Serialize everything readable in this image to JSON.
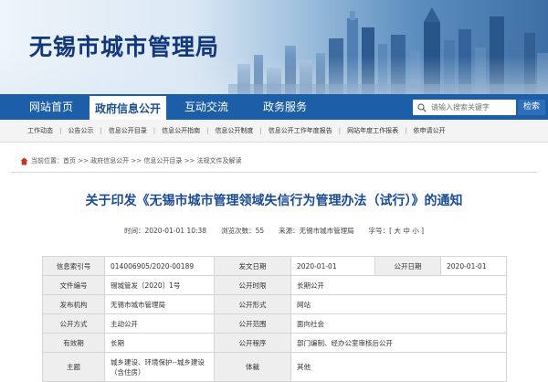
{
  "site": {
    "title": "无锡市城市管理局"
  },
  "nav": {
    "items": [
      {
        "label": "网站首页",
        "active": false
      },
      {
        "label": "政府信息公开",
        "active": true
      },
      {
        "label": "互动交流",
        "active": false
      },
      {
        "label": "政务服务",
        "active": false
      }
    ],
    "search_placeholder": "请输入搜索关键字",
    "search_button": "检索"
  },
  "subnav": {
    "items": [
      "工作动态",
      "公告公示",
      "信息公开目录",
      "信息公开指南",
      "信息公开制度",
      "信息公开工作年度报告",
      "网站年度工作报表",
      "依申请公开"
    ]
  },
  "breadcrumb": {
    "text": "当前位置：首页 >> 政府信息公开 >> 信息公开目录 >> 法规文件及解读"
  },
  "article": {
    "title": "关于印发《无锡市城市管理领域失信行为管理办法（试行）》的通知",
    "time": "时间：2020-01-01 10:38",
    "views": "浏览次数：55",
    "source": "来源：无锡市城市管理局",
    "fontsize": "字号：[ 大 中 小 ]"
  },
  "info_table": {
    "r1": {
      "l1": "信息索引号",
      "v1": "014006905/2020-00189",
      "l2": "发文日期",
      "v2": "2020-01-01",
      "l3": "公开日期",
      "v3": "2020-01-01"
    },
    "r2": {
      "l1": "文件编号",
      "v1": "锡城管发〔2020〕1号",
      "l2": "公开时限",
      "v2": "长期公开"
    },
    "r3": {
      "l1": "发布机构",
      "v1": "无锡市城市管理局",
      "l2": "公开形式",
      "v2": "网站"
    },
    "r4": {
      "l1": "公开方式",
      "v1": "主动公开",
      "l2": "公开范围",
      "v2": "面向社会"
    },
    "r5": {
      "l1": "有效期",
      "v1": "长期",
      "l2": "公开程序",
      "v2": "部门编制、经办公室审核后公开"
    },
    "r6": {
      "l1": "主题",
      "v1": "城乡建设、环境保护--城乡建设（含住房）",
      "l2": "体裁",
      "v2": "其他"
    }
  },
  "colors": {
    "nav_bg": "#1c5fa8",
    "title_blue": "#1a4b93",
    "logo_blue": "#12377a"
  }
}
